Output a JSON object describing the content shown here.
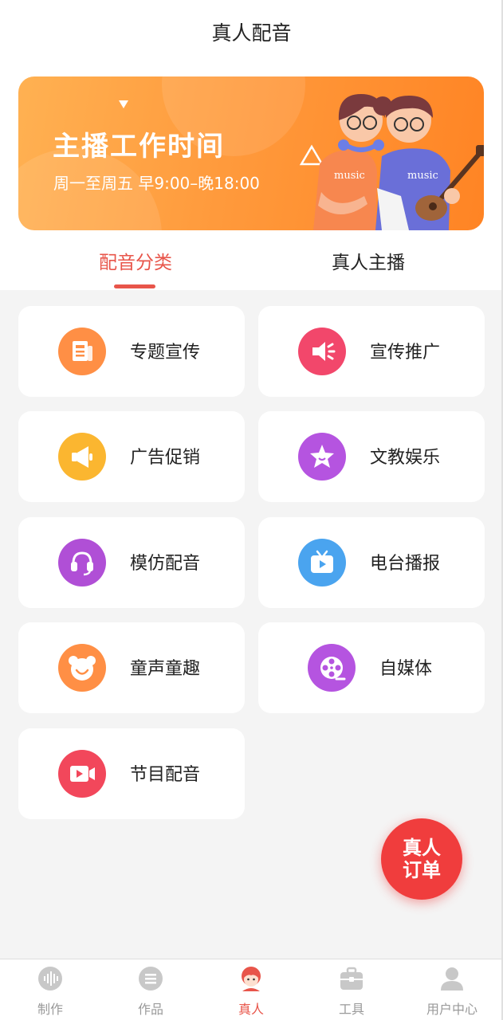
{
  "header": {
    "title": "真人配音"
  },
  "banner": {
    "title": "主播工作时间",
    "subtitle": "周一至周五 早9:00–晚18:00",
    "shirt_text": "music"
  },
  "tabs": [
    {
      "label": "配音分类",
      "active": true
    },
    {
      "label": "真人主播",
      "active": false
    }
  ],
  "categories": [
    {
      "label": "专题宣传",
      "icon": "document-icon",
      "color": "#ff8f45"
    },
    {
      "label": "宣传推广",
      "icon": "megaphone-icon",
      "color": "#f2476b"
    },
    {
      "label": "广告促销",
      "icon": "loudspeaker-icon",
      "color": "#fbb630"
    },
    {
      "label": "文教娱乐",
      "icon": "star-icon",
      "color": "#b554e0"
    },
    {
      "label": "模仿配音",
      "icon": "headset-icon",
      "color": "#b04fd6"
    },
    {
      "label": "电台播报",
      "icon": "tv-play-icon",
      "color": "#4aa4ef"
    },
    {
      "label": "童声童趣",
      "icon": "bear-icon",
      "color": "#ff8f45"
    },
    {
      "label": "自媒体",
      "icon": "film-reel-icon",
      "color": "#b554e0"
    },
    {
      "label": "节目配音",
      "icon": "video-camera-icon",
      "color": "#f2475b"
    }
  ],
  "fab": {
    "line1": "真人",
    "line2": "订单"
  },
  "tabbar": [
    {
      "label": "制作",
      "icon": "waveform-icon",
      "active": false
    },
    {
      "label": "作品",
      "icon": "list-icon",
      "active": false
    },
    {
      "label": "真人",
      "icon": "person-avatar-icon",
      "active": true
    },
    {
      "label": "工具",
      "icon": "toolbox-icon",
      "active": false
    },
    {
      "label": "用户中心",
      "icon": "user-icon",
      "active": false
    }
  ],
  "colors": {
    "accent": "#e8554a",
    "fab": "#f03d3d",
    "banner": "#ff9a3c"
  }
}
